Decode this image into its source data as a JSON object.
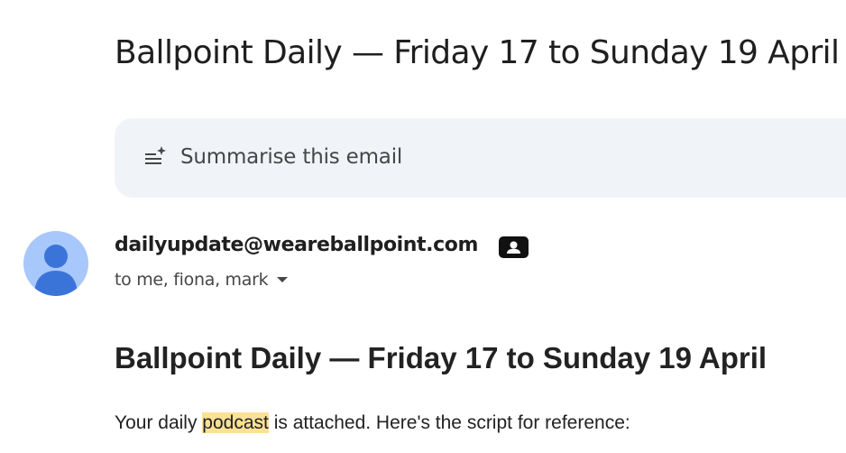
{
  "email": {
    "subject": "Ballpoint Daily — Friday 17 to Sunday 19 April",
    "summarise": {
      "label": "Summarise this email",
      "icon": "sparkle-list-icon"
    },
    "sender": {
      "address": "dailyupdate@weareballpoint.com",
      "avatar_icon": "default-avatar-icon",
      "badge_icon": "contact-card-icon"
    },
    "recipients": {
      "text": "to me, fiona, mark",
      "icon": "caret-down-icon"
    },
    "body": {
      "heading": "Ballpoint Daily — Friday 17 to Sunday 19 April",
      "intro_before": "Your daily ",
      "intro_highlight": "podcast",
      "intro_after": " is attached. Here's the script for reference:"
    }
  },
  "colors": {
    "summarise_bg": "#f0f4f9",
    "avatar_bg": "#a8c7fa",
    "avatar_fg": "#3b74d9",
    "highlight": "#fbe195"
  }
}
